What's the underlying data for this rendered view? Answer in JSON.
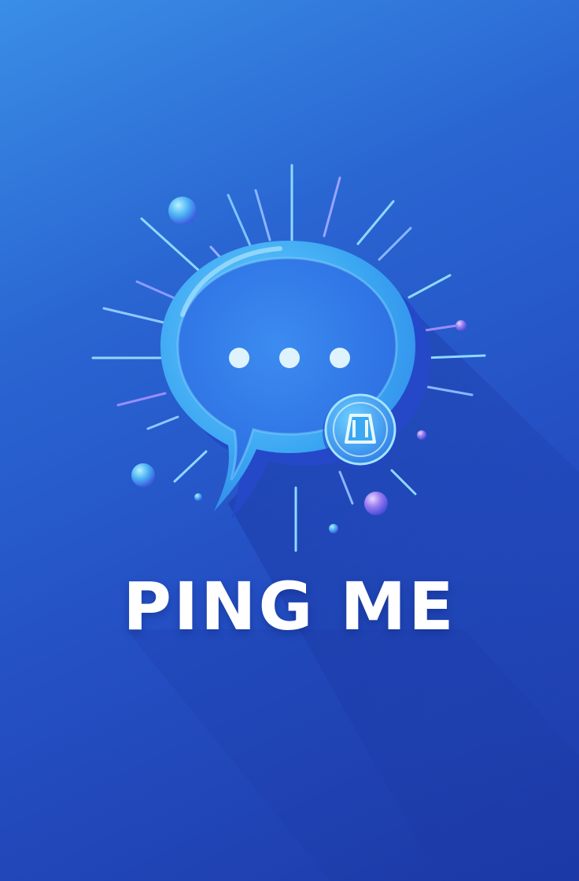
{
  "app": {
    "title": "PING ME",
    "logo_icon": "chat-bubble-icon",
    "badge_icon": "bell-icon"
  },
  "colors": {
    "background_top": "#3a8ee6",
    "background_bottom": "#1d3aa8",
    "bubble": "#3ba6f2",
    "bubble_inner": "#2f78e6",
    "dots": "#dff3ff",
    "title": "#ffffff"
  }
}
